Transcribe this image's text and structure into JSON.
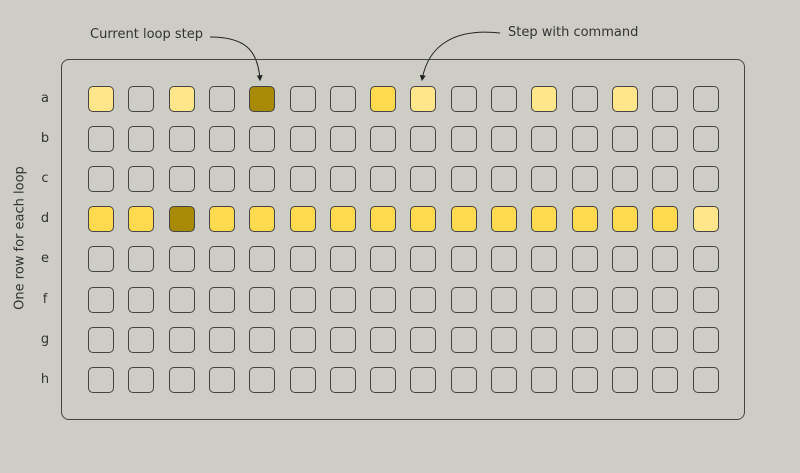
{
  "annotations": {
    "current_step": "Current loop step",
    "step_with_command": "Step with command",
    "side_label": "One row for each loop"
  },
  "legend_colors": {
    "empty": "transparent",
    "command_light": "#ffe68a",
    "command_bright": "#ffd94e",
    "current": "#a88a05"
  },
  "rows": [
    {
      "label": "a",
      "steps": [
        1,
        0,
        1,
        0,
        3,
        0,
        0,
        2,
        1,
        0,
        0,
        1,
        0,
        1,
        0,
        0
      ]
    },
    {
      "label": "b",
      "steps": [
        0,
        0,
        0,
        0,
        0,
        0,
        0,
        0,
        0,
        0,
        0,
        0,
        0,
        0,
        0,
        0
      ]
    },
    {
      "label": "c",
      "steps": [
        0,
        0,
        0,
        0,
        0,
        0,
        0,
        0,
        0,
        0,
        0,
        0,
        0,
        0,
        0,
        0
      ]
    },
    {
      "label": "d",
      "steps": [
        2,
        2,
        3,
        2,
        2,
        2,
        2,
        2,
        2,
        2,
        2,
        2,
        2,
        2,
        2,
        1
      ]
    },
    {
      "label": "e",
      "steps": [
        0,
        0,
        0,
        0,
        0,
        0,
        0,
        0,
        0,
        0,
        0,
        0,
        0,
        0,
        0,
        0
      ]
    },
    {
      "label": "f",
      "steps": [
        0,
        0,
        0,
        0,
        0,
        0,
        0,
        0,
        0,
        0,
        0,
        0,
        0,
        0,
        0,
        0
      ]
    },
    {
      "label": "g",
      "steps": [
        0,
        0,
        0,
        0,
        0,
        0,
        0,
        0,
        0,
        0,
        0,
        0,
        0,
        0,
        0,
        0
      ]
    },
    {
      "label": "h",
      "steps": [
        0,
        0,
        0,
        0,
        0,
        0,
        0,
        0,
        0,
        0,
        0,
        0,
        0,
        0,
        0,
        0
      ]
    }
  ]
}
